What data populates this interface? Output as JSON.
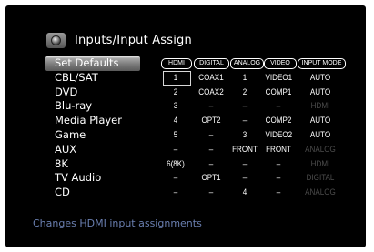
{
  "header": {
    "title": "Inputs/Input Assign"
  },
  "columns": [
    "HDMI",
    "DIGITAL",
    "ANALOG",
    "VIDEO",
    "INPUT MODE"
  ],
  "rows": [
    {
      "label": "Set Defaults",
      "hdmi": "",
      "digital": "",
      "analog": "",
      "video": "",
      "mode": ""
    },
    {
      "label": "CBL/SAT",
      "hdmi": "1",
      "digital": "COAX1",
      "analog": "1",
      "video": "VIDEO1",
      "mode": "AUTO"
    },
    {
      "label": "DVD",
      "hdmi": "2",
      "digital": "COAX2",
      "analog": "2",
      "video": "COMP1",
      "mode": "AUTO"
    },
    {
      "label": "Blu-ray",
      "hdmi": "3",
      "digital": "–",
      "analog": "–",
      "video": "–",
      "mode": "HDMI"
    },
    {
      "label": "Media Player",
      "hdmi": "4",
      "digital": "OPT2",
      "analog": "–",
      "video": "COMP2",
      "mode": "AUTO"
    },
    {
      "label": "Game",
      "hdmi": "5",
      "digital": "–",
      "analog": "3",
      "video": "VIDEO2",
      "mode": "AUTO"
    },
    {
      "label": "AUX",
      "hdmi": "–",
      "digital": "–",
      "analog": "FRONT",
      "video": "FRONT",
      "mode": "ANALOG"
    },
    {
      "label": "8K",
      "hdmi": "6(8K)",
      "digital": "–",
      "analog": "–",
      "video": "–",
      "mode": "HDMI"
    },
    {
      "label": "TV Audio",
      "hdmi": "–",
      "digital": "OPT1",
      "analog": "–",
      "video": "–",
      "mode": "DIGITAL"
    },
    {
      "label": "CD",
      "hdmi": "–",
      "digital": "–",
      "analog": "4",
      "video": "–",
      "mode": "ANALOG"
    }
  ],
  "hint": "Changes HDMI input assignments"
}
